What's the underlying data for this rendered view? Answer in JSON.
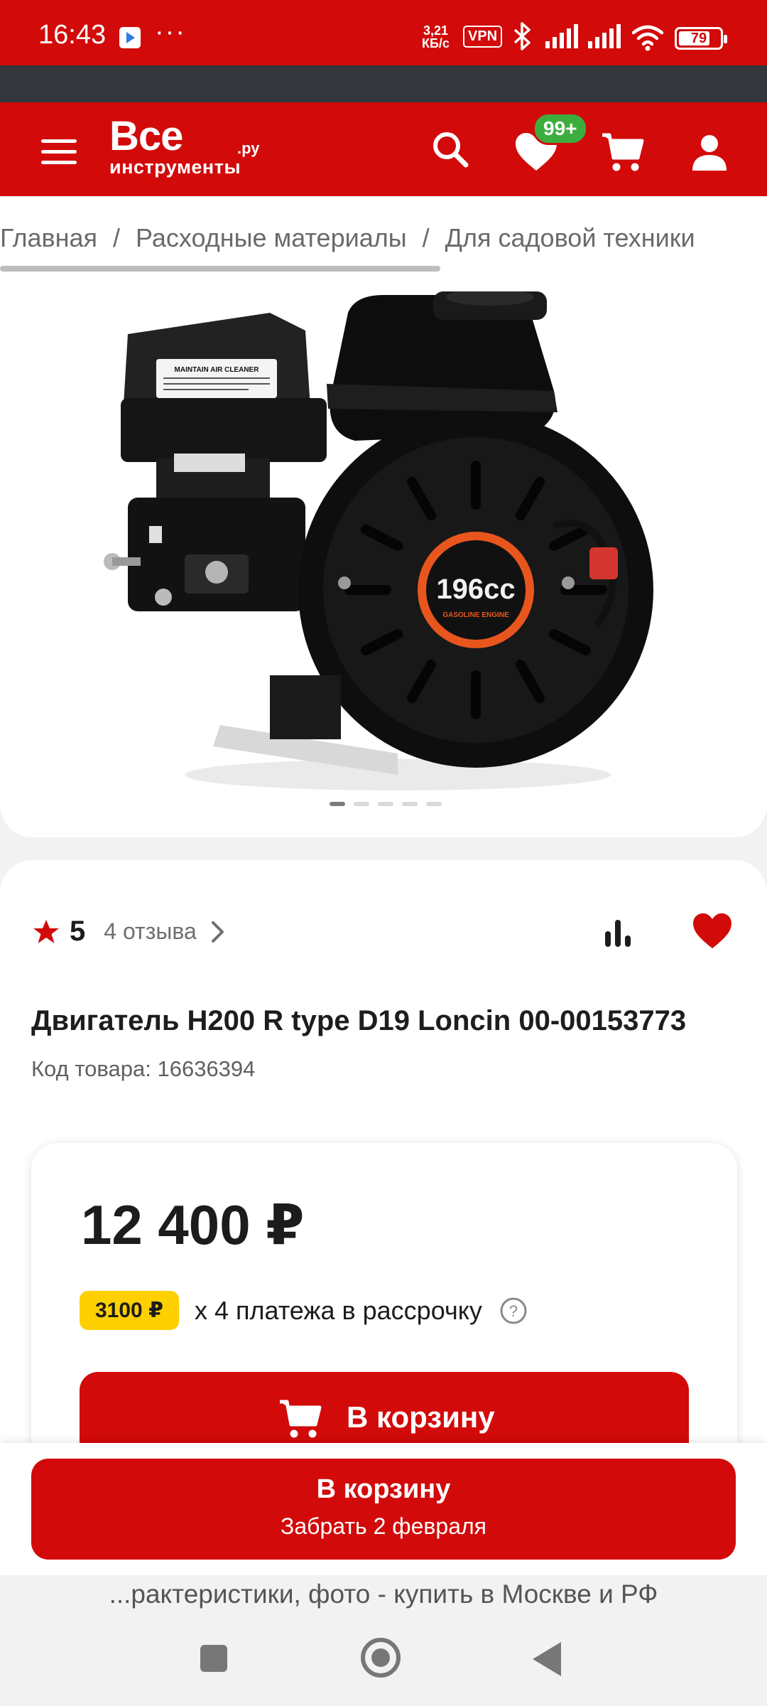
{
  "status": {
    "time": "16:43",
    "dots": "···",
    "speed_value": "3,21",
    "speed_unit": "КБ/с",
    "vpn": "VPN",
    "battery": "79",
    "battery_level": 0.79
  },
  "header": {
    "logo_line1": "Все",
    "logo_line2": "инструменты",
    "logo_ru": ".ру",
    "favorites_badge": "99+"
  },
  "breadcrumbs": [
    "Главная",
    "Расходные материалы",
    "Для садовой техники"
  ],
  "gallery": {
    "engine_badge": "196cc",
    "engine_sub": "GASOLINE ENGINE",
    "air_cleaner_label": "MAINTAIN AIR CLEANER",
    "slides": 5,
    "active_slide": 1
  },
  "product": {
    "rating": "5",
    "reviews": "4 отзыва",
    "title": "Двигатель H200 R type D19 Loncin 00-00153773",
    "code": "Код товара: 16636394",
    "price": "12 400 ₽",
    "installment_chip": "3100 ₽",
    "installment_text": "х 4 платежа в рассрочку",
    "help_icon": "?",
    "add_to_cart": "В корзину"
  },
  "sticky": {
    "button_label": "В корзину",
    "button_sub": "Забрать 2 февраля"
  },
  "page_title": "...рактеристики, фото - купить в Москве и РФ",
  "colors": {
    "brand_red": "#d20a0a",
    "badge_green": "#3dae3d",
    "installment_yellow": "#ffd000"
  }
}
